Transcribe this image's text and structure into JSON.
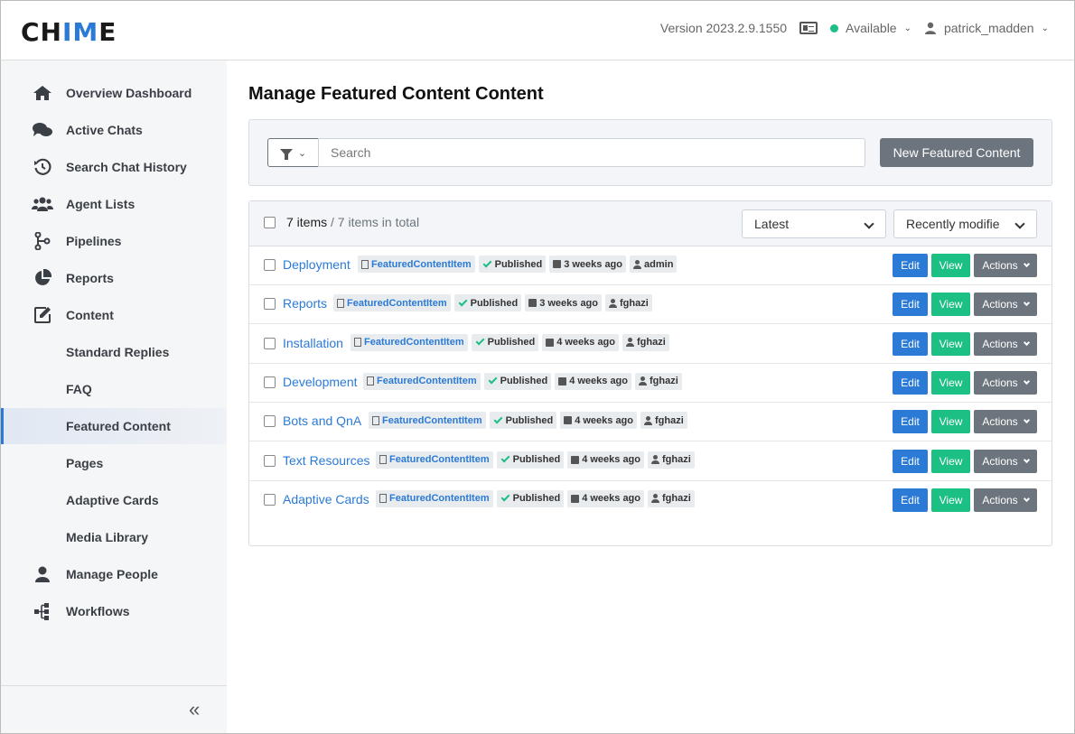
{
  "header": {
    "logo_prefix": "CH",
    "logo_accent": "IM",
    "logo_suffix": "E",
    "version": "Version 2023.2.9.1550",
    "status": "Available",
    "user": "patrick_madden",
    "status_color": "#1cbf84"
  },
  "sidebar": {
    "items": [
      {
        "label": "Overview Dashboard",
        "icon": "home-icon"
      },
      {
        "label": "Active Chats",
        "icon": "chat-bubbles-icon"
      },
      {
        "label": "Search Chat History",
        "icon": "history-icon"
      },
      {
        "label": "Agent Lists",
        "icon": "users-icon"
      },
      {
        "label": "Pipelines",
        "icon": "pipeline-icon"
      },
      {
        "label": "Reports",
        "icon": "pie-chart-icon"
      },
      {
        "label": "Content",
        "icon": "edit-icon"
      },
      {
        "label": "Standard Replies"
      },
      {
        "label": "FAQ"
      },
      {
        "label": "Featured Content",
        "active": true
      },
      {
        "label": "Pages"
      },
      {
        "label": "Adaptive Cards"
      },
      {
        "label": "Media Library"
      },
      {
        "label": "Manage People",
        "icon": "person-icon"
      },
      {
        "label": "Workflows",
        "icon": "workflow-icon"
      }
    ],
    "collapse_label": "«"
  },
  "main": {
    "title": "Manage Featured Content Content",
    "search_placeholder": "Search",
    "new_button": "New Featured Content",
    "count_items": "7 items",
    "count_total": " / 7 items in total",
    "sort_select": "Latest",
    "sort_field_select": "Recently modifie",
    "rows": [
      {
        "title": "Deployment",
        "type": "FeaturedContentItem",
        "status": "Published",
        "age": "3 weeks ago",
        "author": "admin"
      },
      {
        "title": "Reports",
        "type": "FeaturedContentItem",
        "status": "Published",
        "age": "3 weeks ago",
        "author": "fghazi"
      },
      {
        "title": "Installation",
        "type": "FeaturedContentItem",
        "status": "Published",
        "age": "4 weeks ago",
        "author": "fghazi"
      },
      {
        "title": "Development",
        "type": "FeaturedContentItem",
        "status": "Published",
        "age": "4 weeks ago",
        "author": "fghazi"
      },
      {
        "title": "Bots and QnA",
        "type": "FeaturedContentItem",
        "status": "Published",
        "age": "4 weeks ago",
        "author": "fghazi"
      },
      {
        "title": "Text Resources",
        "type": "FeaturedContentItem",
        "status": "Published",
        "age": "4 weeks ago",
        "author": "fghazi"
      },
      {
        "title": "Adaptive Cards",
        "type": "FeaturedContentItem",
        "status": "Published",
        "age": "4 weeks ago",
        "author": "fghazi"
      }
    ],
    "edit_label": "Edit",
    "view_label": "View",
    "actions_label": "Actions",
    "colors": {
      "primary": "#2a7ad6",
      "success": "#1cbf84",
      "secondary": "#6c757d"
    }
  }
}
